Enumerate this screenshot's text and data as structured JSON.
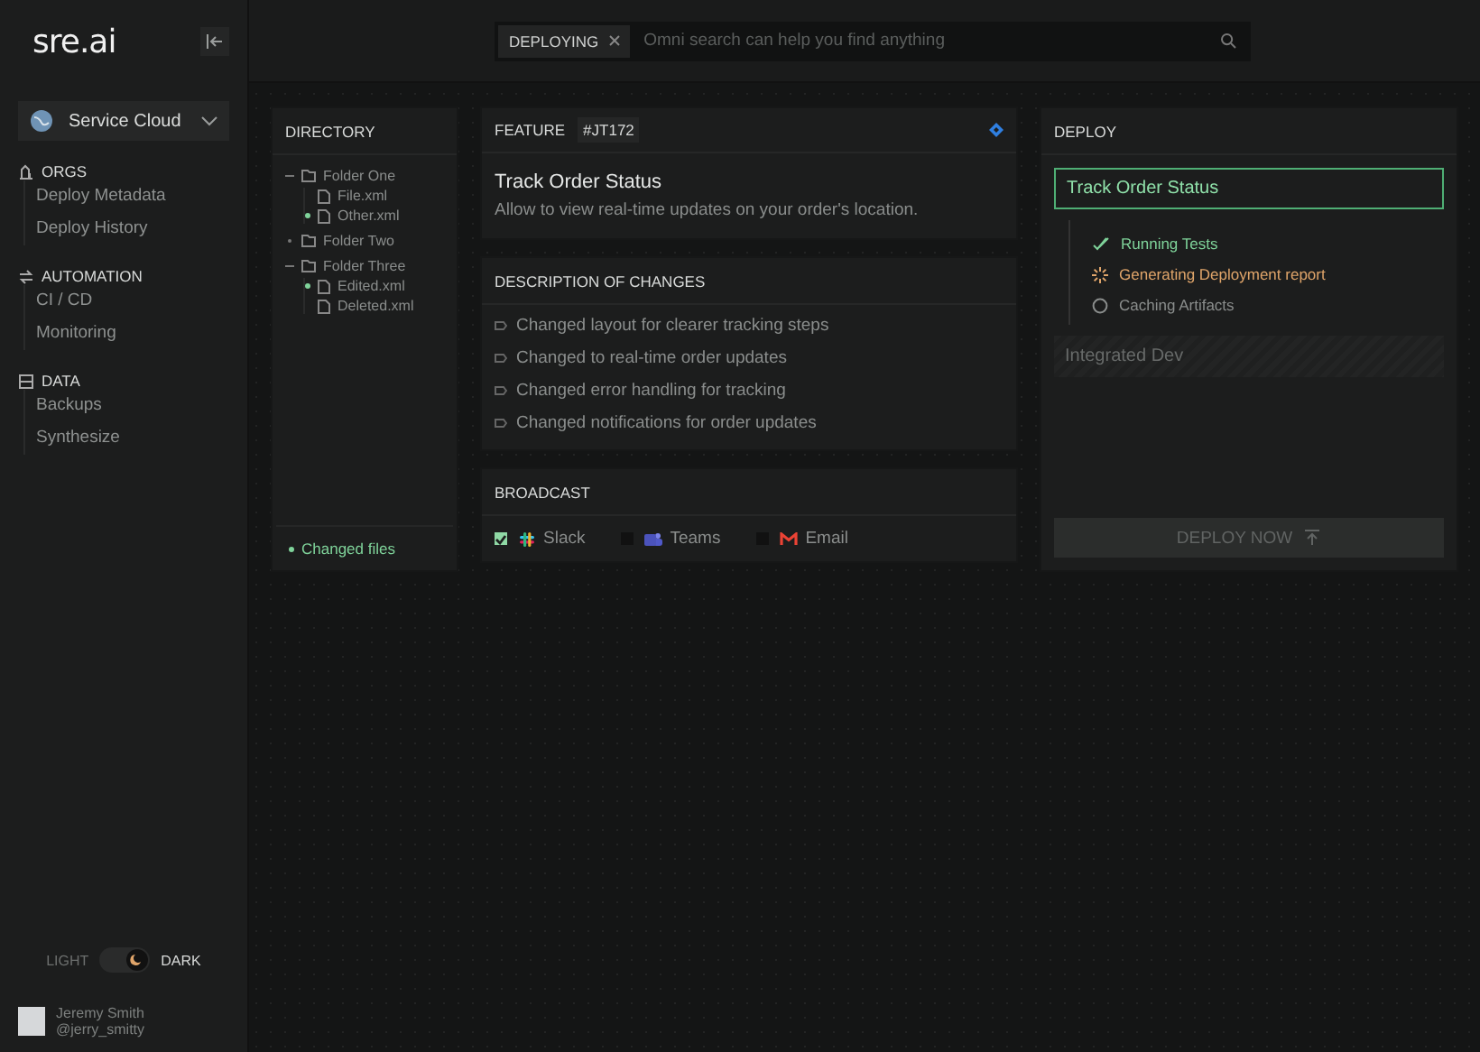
{
  "sidebar": {
    "logo": "sre.ai",
    "workspace": "Service Cloud",
    "sections": [
      {
        "kind": "orgs",
        "title": "ORGS",
        "items": [
          "Deploy Metadata",
          "Deploy History"
        ]
      },
      {
        "kind": "automation",
        "title": "AUTOMATION",
        "items": [
          "CI / CD",
          "Monitoring"
        ]
      },
      {
        "kind": "data",
        "title": "DATA",
        "items": [
          "Backups",
          "Synthesize"
        ]
      }
    ],
    "theme": {
      "light_label": "LIGHT",
      "dark_label": "DARK",
      "dark": true
    },
    "user": {
      "name": "Jeremy Smith",
      "handle": "@jerry_smitty"
    }
  },
  "search": {
    "tag": "DEPLOYING",
    "placeholder": "Omni search can help you find anything"
  },
  "directory": {
    "title": "DIRECTORY",
    "legend": "Changed files",
    "tree": [
      {
        "name": "Folder One",
        "expanded": true,
        "children": [
          {
            "name": "File.xml",
            "changed": false
          },
          {
            "name": "Other.xml",
            "changed": true
          }
        ]
      },
      {
        "name": "Folder Two",
        "expanded": false
      },
      {
        "name": "Folder Three",
        "expanded": true,
        "children": [
          {
            "name": "Edited.xml",
            "changed": true
          },
          {
            "name": "Deleted.xml",
            "changed": false
          }
        ]
      }
    ]
  },
  "feature": {
    "label": "FEATURE",
    "id": "#JT172",
    "title": "Track Order Status",
    "description": "Allow to view real-time updates on your order's location."
  },
  "changes": {
    "title": "DESCRIPTION OF CHANGES",
    "items": [
      "Changed layout for clearer tracking steps",
      "Changed to real-time order updates",
      "Changed error handling for tracking",
      "Changed notifications for order updates"
    ]
  },
  "broadcast": {
    "title": "BROADCAST",
    "channels": [
      {
        "kind": "slack",
        "name": "Slack",
        "checked": true
      },
      {
        "kind": "teams",
        "name": "Teams",
        "checked": false
      },
      {
        "kind": "email",
        "name": "Email",
        "checked": false
      }
    ]
  },
  "deploy": {
    "title": "DEPLOY",
    "target": "Track Order Status",
    "steps": [
      {
        "label": "Running Tests",
        "kind": "done"
      },
      {
        "label": "Generating Deployment report",
        "kind": "running"
      },
      {
        "label": "Caching Artifacts",
        "kind": "pending"
      }
    ],
    "environment": "Integrated Dev",
    "button": "DEPLOY NOW",
    "disabled": true
  }
}
